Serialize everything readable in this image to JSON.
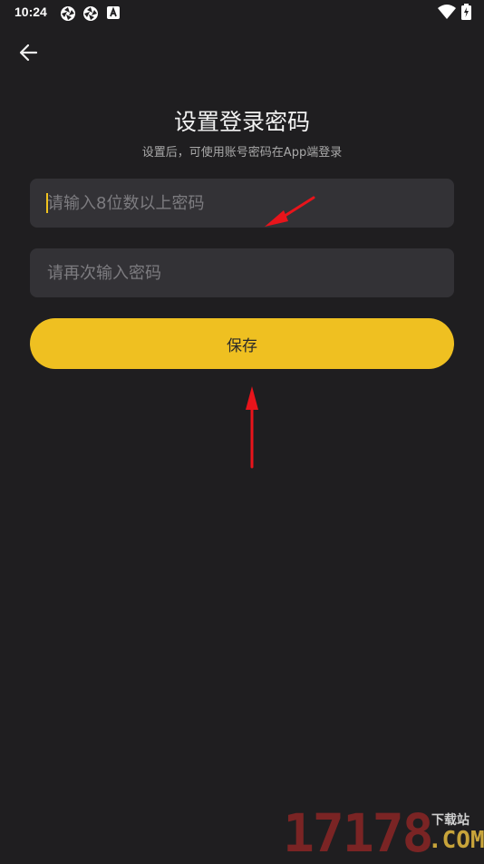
{
  "status_bar": {
    "time": "10:24"
  },
  "header": {
    "title": "设置登录密码",
    "subtitle": "设置后，可使用账号密码在App端登录"
  },
  "form": {
    "password_placeholder": "请输入8位数以上密码",
    "confirm_placeholder": "请再次输入密码",
    "save_label": "保存"
  },
  "watermark": {
    "number": "17178",
    "cn": "下载站",
    "dotcom": ".COM"
  },
  "colors": {
    "background": "#1f1e20",
    "accent": "#efc021",
    "field": "#333236",
    "annotation": "#e8141b"
  }
}
